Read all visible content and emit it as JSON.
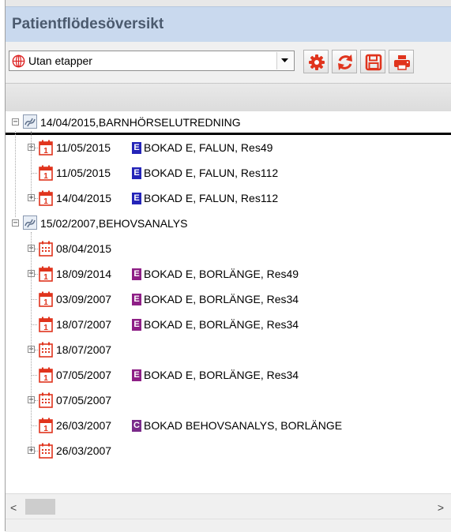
{
  "window": {
    "title": "Patientflödesöversikt"
  },
  "toolbar": {
    "selector_value": "Utan etapper",
    "buttons": [
      {
        "name": "settings-button",
        "icon": "gear-icon"
      },
      {
        "name": "refresh-button",
        "icon": "refresh-icon"
      },
      {
        "name": "save-button",
        "icon": "floppy-disk-icon"
      },
      {
        "name": "print-button",
        "icon": "printer-icon"
      }
    ]
  },
  "colors": {
    "title_bg": "#c9d9ee",
    "icon_red": "#e0341d",
    "badge_blue": "#2424b8",
    "badge_purple": "#8e1f86",
    "badge_purple2": "#7a2a8a"
  },
  "tree": {
    "rows": [
      {
        "level": 0,
        "expander": "minus",
        "icon": "flow-icon",
        "date": "14/04/2015",
        "badge": "",
        "desc": " ,BARNHÖRSELUTREDNING",
        "selected": true
      },
      {
        "level": 1,
        "expander": "plus",
        "icon": "calendar-day-icon",
        "date": "11/05/2015",
        "badge": "E",
        "badge_color": "blue",
        "desc": "BOKAD E, FALUN, Res49"
      },
      {
        "level": 1,
        "expander": "none",
        "icon": "calendar-day-icon",
        "date": "11/05/2015",
        "badge": "E",
        "badge_color": "blue",
        "desc": "BOKAD E, FALUN, Res112"
      },
      {
        "level": 1,
        "expander": "plus",
        "icon": "calendar-day-icon",
        "date": "14/04/2015",
        "badge": "E",
        "badge_color": "blue",
        "desc": "BOKAD E, FALUN, Res112"
      },
      {
        "level": 0,
        "expander": "minus",
        "icon": "flow-icon",
        "date": "15/02/2007",
        "badge": "",
        "desc": " ,BEHOVSANALYS"
      },
      {
        "level": 1,
        "expander": "plus",
        "icon": "calendar-month-icon",
        "date": "08/04/2015",
        "badge": "",
        "desc": ""
      },
      {
        "level": 1,
        "expander": "plus",
        "icon": "calendar-day-icon",
        "date": "18/09/2014",
        "badge": "E",
        "badge_color": "purple",
        "desc": "BOKAD E, BORLÄNGE, Res49"
      },
      {
        "level": 1,
        "expander": "none",
        "icon": "calendar-day-icon",
        "date": "03/09/2007",
        "badge": "E",
        "badge_color": "purple",
        "desc": "BOKAD E, BORLÄNGE, Res34"
      },
      {
        "level": 1,
        "expander": "none",
        "icon": "calendar-day-icon",
        "date": "18/07/2007",
        "badge": "E",
        "badge_color": "purple",
        "desc": "BOKAD E, BORLÄNGE, Res34"
      },
      {
        "level": 1,
        "expander": "plus",
        "icon": "calendar-month-icon",
        "date": "18/07/2007",
        "badge": "",
        "desc": ""
      },
      {
        "level": 1,
        "expander": "none",
        "icon": "calendar-day-icon",
        "date": "07/05/2007",
        "badge": "E",
        "badge_color": "purple",
        "desc": "BOKAD E, BORLÄNGE, Res34"
      },
      {
        "level": 1,
        "expander": "plus",
        "icon": "calendar-month-icon",
        "date": "07/05/2007",
        "badge": "",
        "desc": ""
      },
      {
        "level": 1,
        "expander": "none",
        "icon": "calendar-day-icon",
        "date": "26/03/2007",
        "badge": "C",
        "badge_color": "purple2",
        "desc": "BOKAD BEHOVSANALYS, BORLÄNGE"
      },
      {
        "level": 1,
        "expander": "plus",
        "icon": "calendar-month-icon",
        "date": "26/03/2007",
        "badge": "",
        "desc": ""
      }
    ]
  },
  "scrollbar": {
    "left_arrow": "<",
    "right_arrow": ">"
  }
}
